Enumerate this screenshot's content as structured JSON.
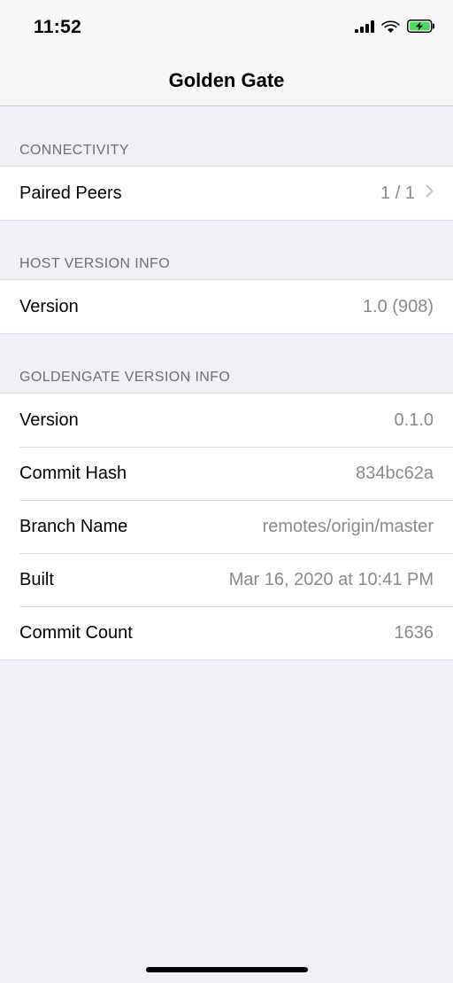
{
  "status_bar": {
    "time": "11:52",
    "icons": [
      "cellular-signal-icon",
      "wifi-icon",
      "battery-charging-icon"
    ],
    "battery_color": "#4cd964"
  },
  "nav": {
    "title": "Golden Gate"
  },
  "sections": {
    "connectivity": {
      "header": "CONNECTIVITY",
      "rows": [
        {
          "label": "Paired Peers",
          "value": "1 / 1"
        }
      ]
    },
    "host_version_info": {
      "header": "HOST VERSION INFO",
      "rows": [
        {
          "label": "Version",
          "value": "1.0 (908)"
        }
      ]
    },
    "goldengate_version_info": {
      "header": "GOLDENGATE VERSION INFO",
      "rows": [
        {
          "label": "Version",
          "value": "0.1.0"
        },
        {
          "label": "Commit Hash",
          "value": "834bc62a"
        },
        {
          "label": "Branch Name",
          "value": "remotes/origin/master"
        },
        {
          "label": "Built",
          "value": "Mar 16, 2020 at 10:41 PM"
        },
        {
          "label": "Commit Count",
          "value": "1636"
        }
      ]
    }
  },
  "colors": {
    "background": "#f0eff5",
    "section_header": "#6d6d72",
    "value_text": "#8a8a8e",
    "chevron": "#c4c4c9"
  }
}
